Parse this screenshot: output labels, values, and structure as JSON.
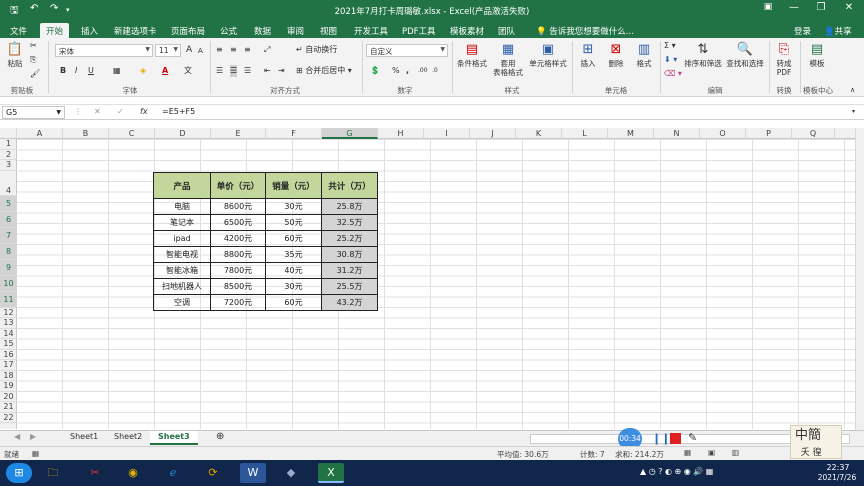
{
  "window": {
    "title": "2021年7月打卡周璐敏.xlsx - Excel(产品激活失败)",
    "save_icon": "save-icon",
    "undo": "↶",
    "redo": "↷"
  },
  "titlebar": {
    "min": "—",
    "restore": "❐",
    "close": "✕"
  },
  "tabs": [
    "文件",
    "开始",
    "插入",
    "新建选项卡",
    "页面布局",
    "公式",
    "数据",
    "审阅",
    "视图",
    "开发工具",
    "PDF工具",
    "模板素材",
    "团队"
  ],
  "tell_me": "告诉我您想要做什么...",
  "login": "登录",
  "share": "共享",
  "ribbon": {
    "paste": "粘贴",
    "clipboard": "剪贴板",
    "font_name": "宋体",
    "font_size": "11",
    "font_group": "字体",
    "bold": "B",
    "italic": "I",
    "underline": "U",
    "grow": "A",
    "shrink": "A",
    "wrap": "自动换行",
    "merge": "合并后居中",
    "align_group": "对齐方式",
    "num_fmt": "自定义",
    "num_group": "数字",
    "pct": "%",
    "comma": ",",
    "cond": "条件格式",
    "table_fmt_1": "套用",
    "table_fmt_2": "表格格式",
    "cell_style": "单元格样式",
    "style_group": "样式",
    "insert": "插入",
    "delete": "删除",
    "format": "格式",
    "cells_group": "单元格",
    "sort": "排序和筛选",
    "find": "查找和选择",
    "edit_group": "编辑",
    "topdf_1": "转成",
    "topdf_2": "PDF",
    "convert_group": "转换",
    "template": "模板",
    "template_group": "模板中心"
  },
  "formula_bar": {
    "name_box": "G5",
    "cancel": "✕",
    "enter": "✓",
    "fx": "fx",
    "formula": "=E5+F5"
  },
  "columns": [
    "A",
    "B",
    "C",
    "D",
    "E",
    "F",
    "G",
    "H",
    "I",
    "J",
    "K",
    "L",
    "M",
    "N",
    "O",
    "P",
    "Q"
  ],
  "rows": [
    "1",
    "2",
    "3",
    "4",
    "5",
    "6",
    "7",
    "8",
    "9",
    "10",
    "11",
    "12",
    "13",
    "14",
    "15",
    "16",
    "17",
    "18",
    "19",
    "20",
    "21",
    "22"
  ],
  "table": {
    "headers": [
      "产品",
      "单价（元）",
      "销量（元）",
      "共计（万）"
    ],
    "rows": [
      [
        "电脑",
        "8600元",
        "30元",
        "25.8万"
      ],
      [
        "笔记本",
        "6500元",
        "50元",
        "32.5万"
      ],
      [
        "ipad",
        "4200元",
        "60元",
        "25.2万"
      ],
      [
        "智能电视",
        "8800元",
        "35元",
        "30.8万"
      ],
      [
        "智能冰箱",
        "7800元",
        "40元",
        "31.2万"
      ],
      [
        "扫地机器人",
        "8500元",
        "30元",
        "25.5万"
      ],
      [
        "空调",
        "7200元",
        "60元",
        "43.2万"
      ]
    ]
  },
  "sheets": [
    "Sheet1",
    "Sheet2",
    "Sheet3"
  ],
  "active_sheet": "Sheet3",
  "status": {
    "mode": "就绪",
    "avg": "平均值: 30.6万",
    "count": "计数: 7",
    "sum": "求和: 214.2万"
  },
  "recorder": {
    "time": "00:34"
  },
  "clock": {
    "time": "22:37",
    "date": "2021/7/26"
  },
  "colors": {
    "accent": "#217346",
    "header_fill": "#c3d69b",
    "selection_fill": "#d4d4d4"
  }
}
